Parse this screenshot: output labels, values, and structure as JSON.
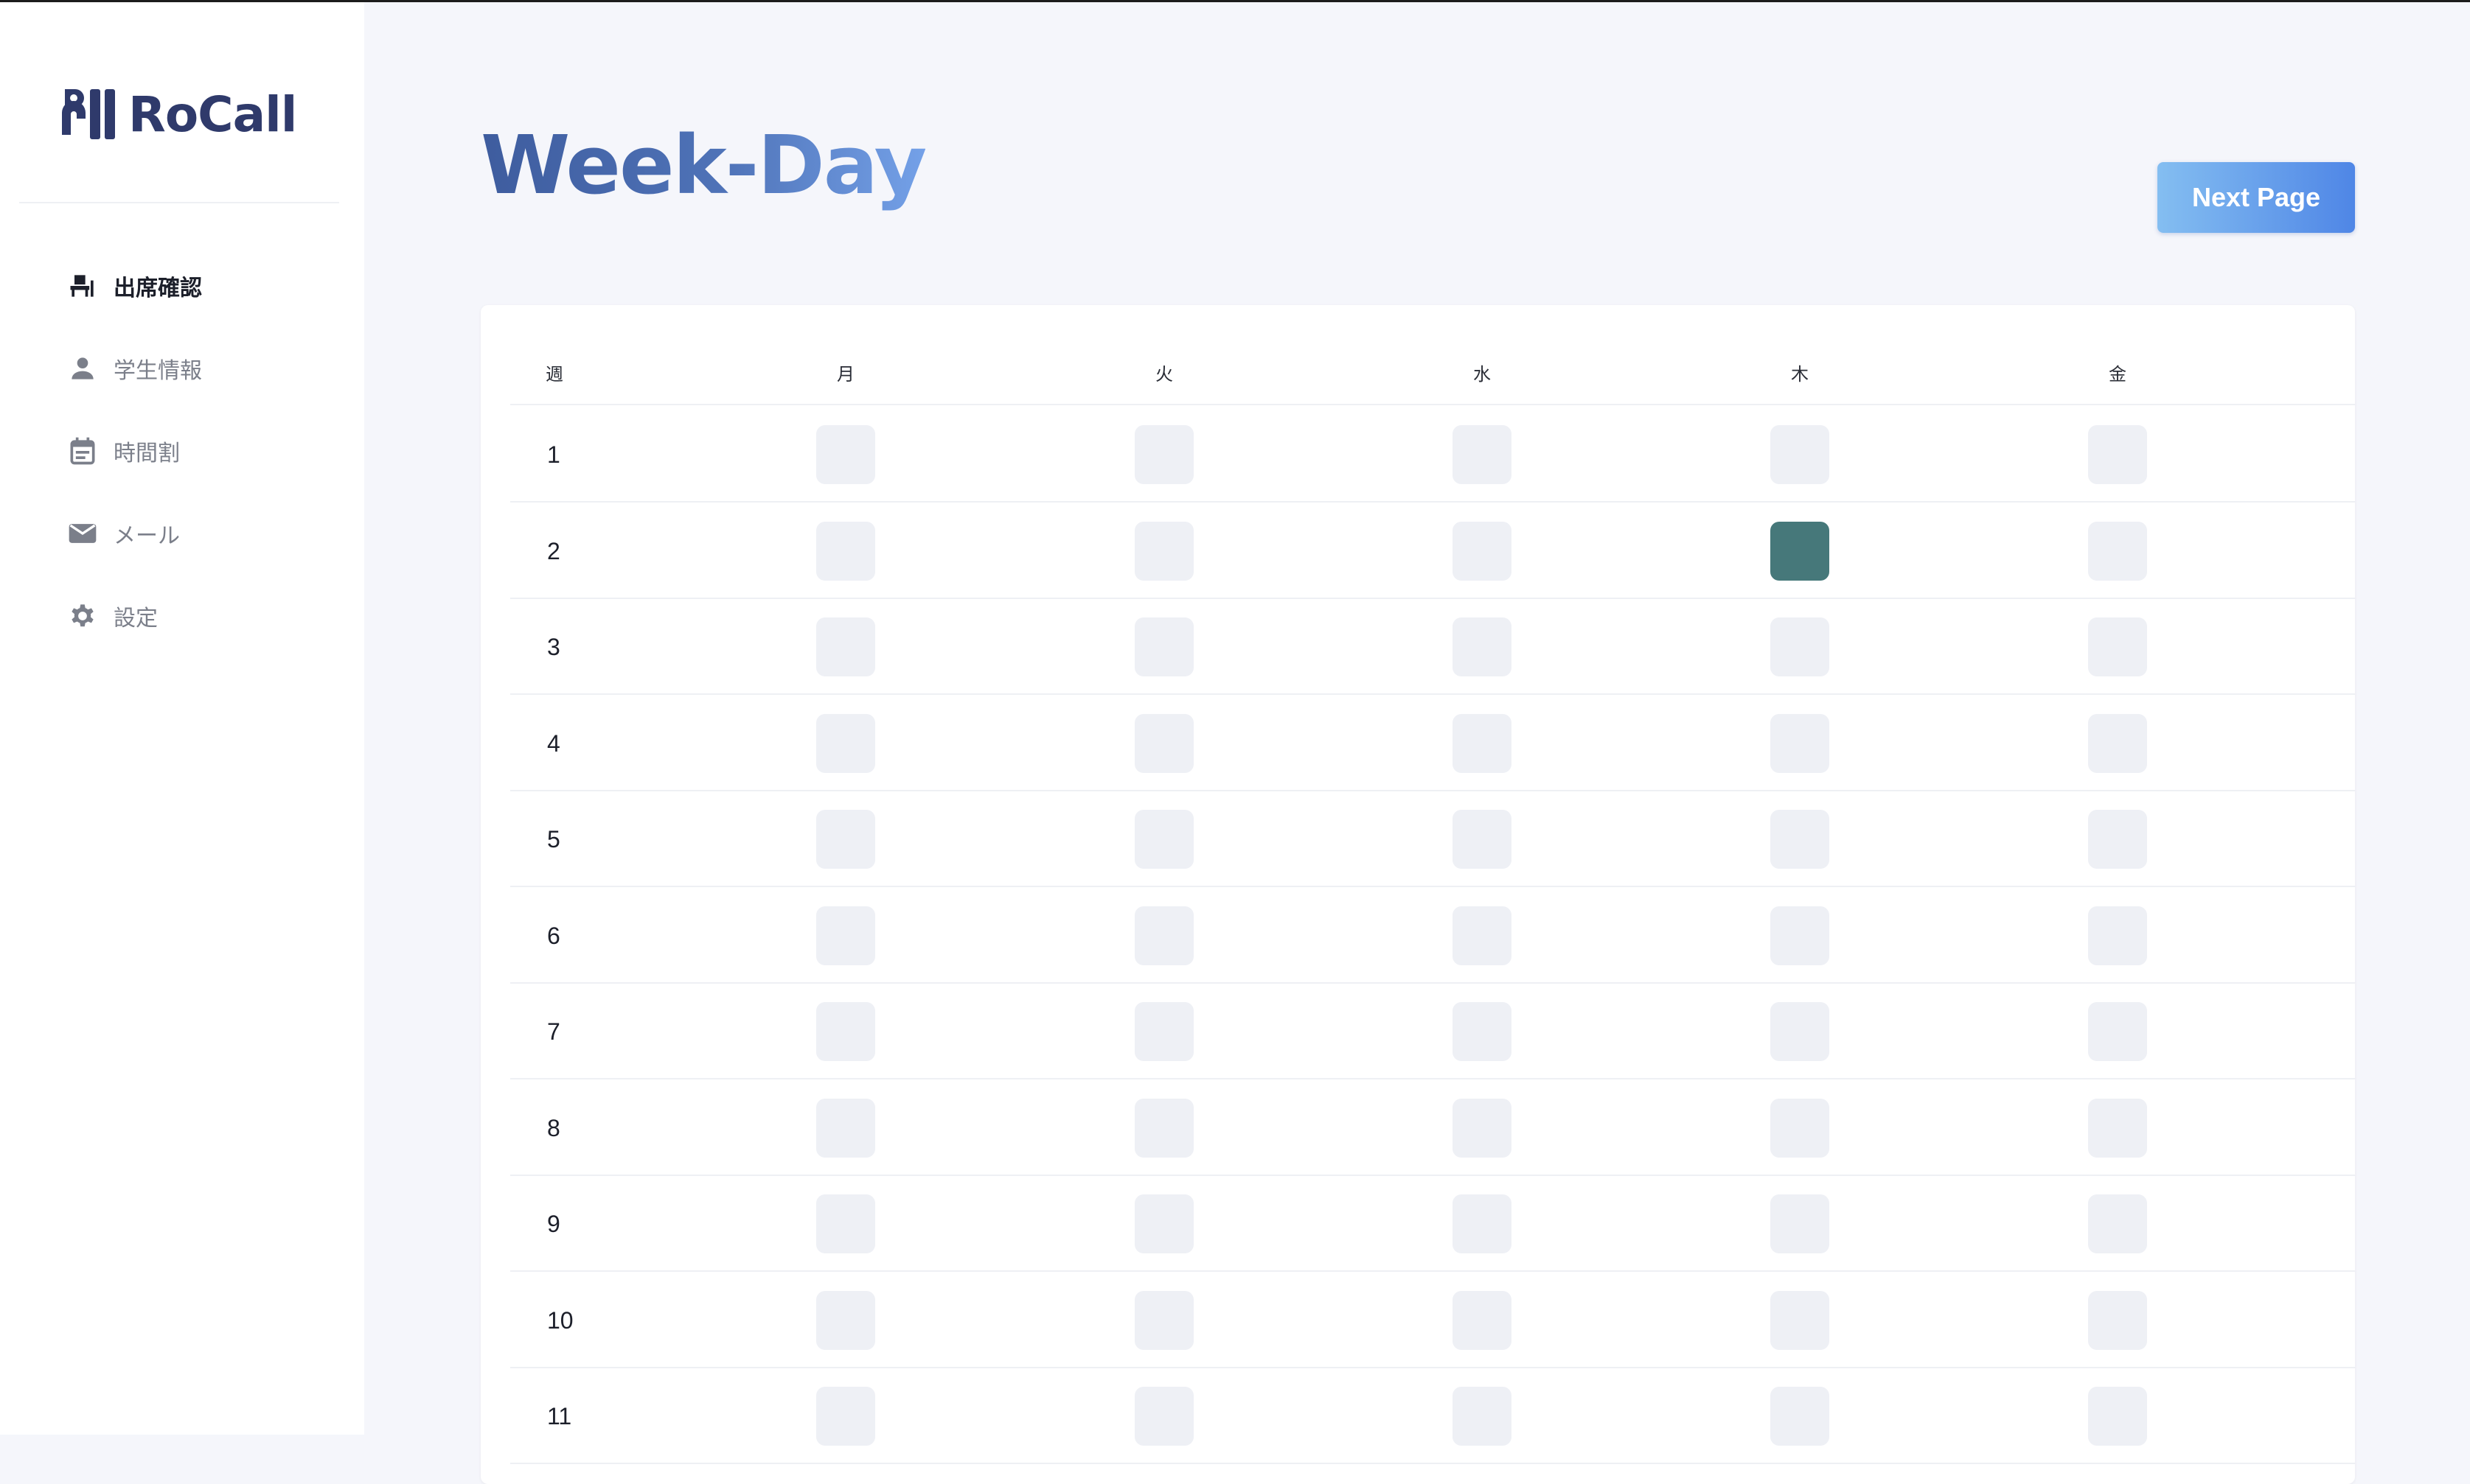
{
  "app": {
    "name": "RoCall"
  },
  "sidebar": {
    "items": [
      {
        "label": "出席確認",
        "icon": "seat-icon",
        "active": true
      },
      {
        "label": "学生情報",
        "icon": "person-icon",
        "active": false
      },
      {
        "label": "時間割",
        "icon": "calendar-icon",
        "active": false
      },
      {
        "label": "メール",
        "icon": "mail-icon",
        "active": false
      },
      {
        "label": "設定",
        "icon": "gear-icon",
        "active": false
      }
    ]
  },
  "page": {
    "title": "Week-Day",
    "next_button": "Next Page"
  },
  "table": {
    "headers": [
      "週",
      "月",
      "火",
      "水",
      "木",
      "金"
    ],
    "rows": [
      {
        "week": "1",
        "cells": [
          false,
          false,
          false,
          false,
          false
        ]
      },
      {
        "week": "2",
        "cells": [
          false,
          false,
          false,
          true,
          false
        ]
      },
      {
        "week": "3",
        "cells": [
          false,
          false,
          false,
          false,
          false
        ]
      },
      {
        "week": "4",
        "cells": [
          false,
          false,
          false,
          false,
          false
        ]
      },
      {
        "week": "5",
        "cells": [
          false,
          false,
          false,
          false,
          false
        ]
      },
      {
        "week": "6",
        "cells": [
          false,
          false,
          false,
          false,
          false
        ]
      },
      {
        "week": "7",
        "cells": [
          false,
          false,
          false,
          false,
          false
        ]
      },
      {
        "week": "8",
        "cells": [
          false,
          false,
          false,
          false,
          false
        ]
      },
      {
        "week": "9",
        "cells": [
          false,
          false,
          false,
          false,
          false
        ]
      },
      {
        "week": "10",
        "cells": [
          false,
          false,
          false,
          false,
          false
        ]
      },
      {
        "week": "11",
        "cells": [
          false,
          false,
          false,
          false,
          false
        ]
      }
    ]
  },
  "colors": {
    "accent": "#4f86e6",
    "cell_empty": "#eef0f5",
    "cell_selected": "#46787a",
    "logo": "#2f3a6b"
  }
}
